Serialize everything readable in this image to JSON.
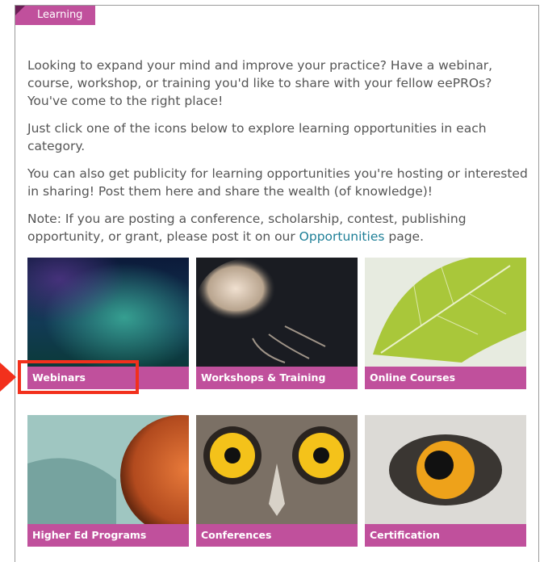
{
  "section_tag": {
    "label": "Learning"
  },
  "intro": {
    "p1": "Looking to expand your mind and improve your practice? Have a webinar, course, workshop, or training you'd like to share with your fellow eePROs? You've come to the right place!",
    "p2": "Just click one of the icons below to explore learning opportunities in each category.",
    "p3": "You can also get publicity for learning opportunities you're hosting or interested in sharing! Post them here and share the wealth (of knowledge)!",
    "p4_before": "Note: If you are posting a conference, scholarship, contest, publishing opportunity, or grant, please post it on our ",
    "p4_link": "Opportunities",
    "p4_after": " page."
  },
  "tiles": [
    {
      "label": "Webinars"
    },
    {
      "label": "Workshops & Training"
    },
    {
      "label": "Online Courses"
    },
    {
      "label": "Higher Ed Programs"
    },
    {
      "label": "Conferences"
    },
    {
      "label": "Certification"
    }
  ],
  "colors": {
    "accent": "#c0509c",
    "link": "#1e7f97",
    "annotation": "#f2301c"
  }
}
